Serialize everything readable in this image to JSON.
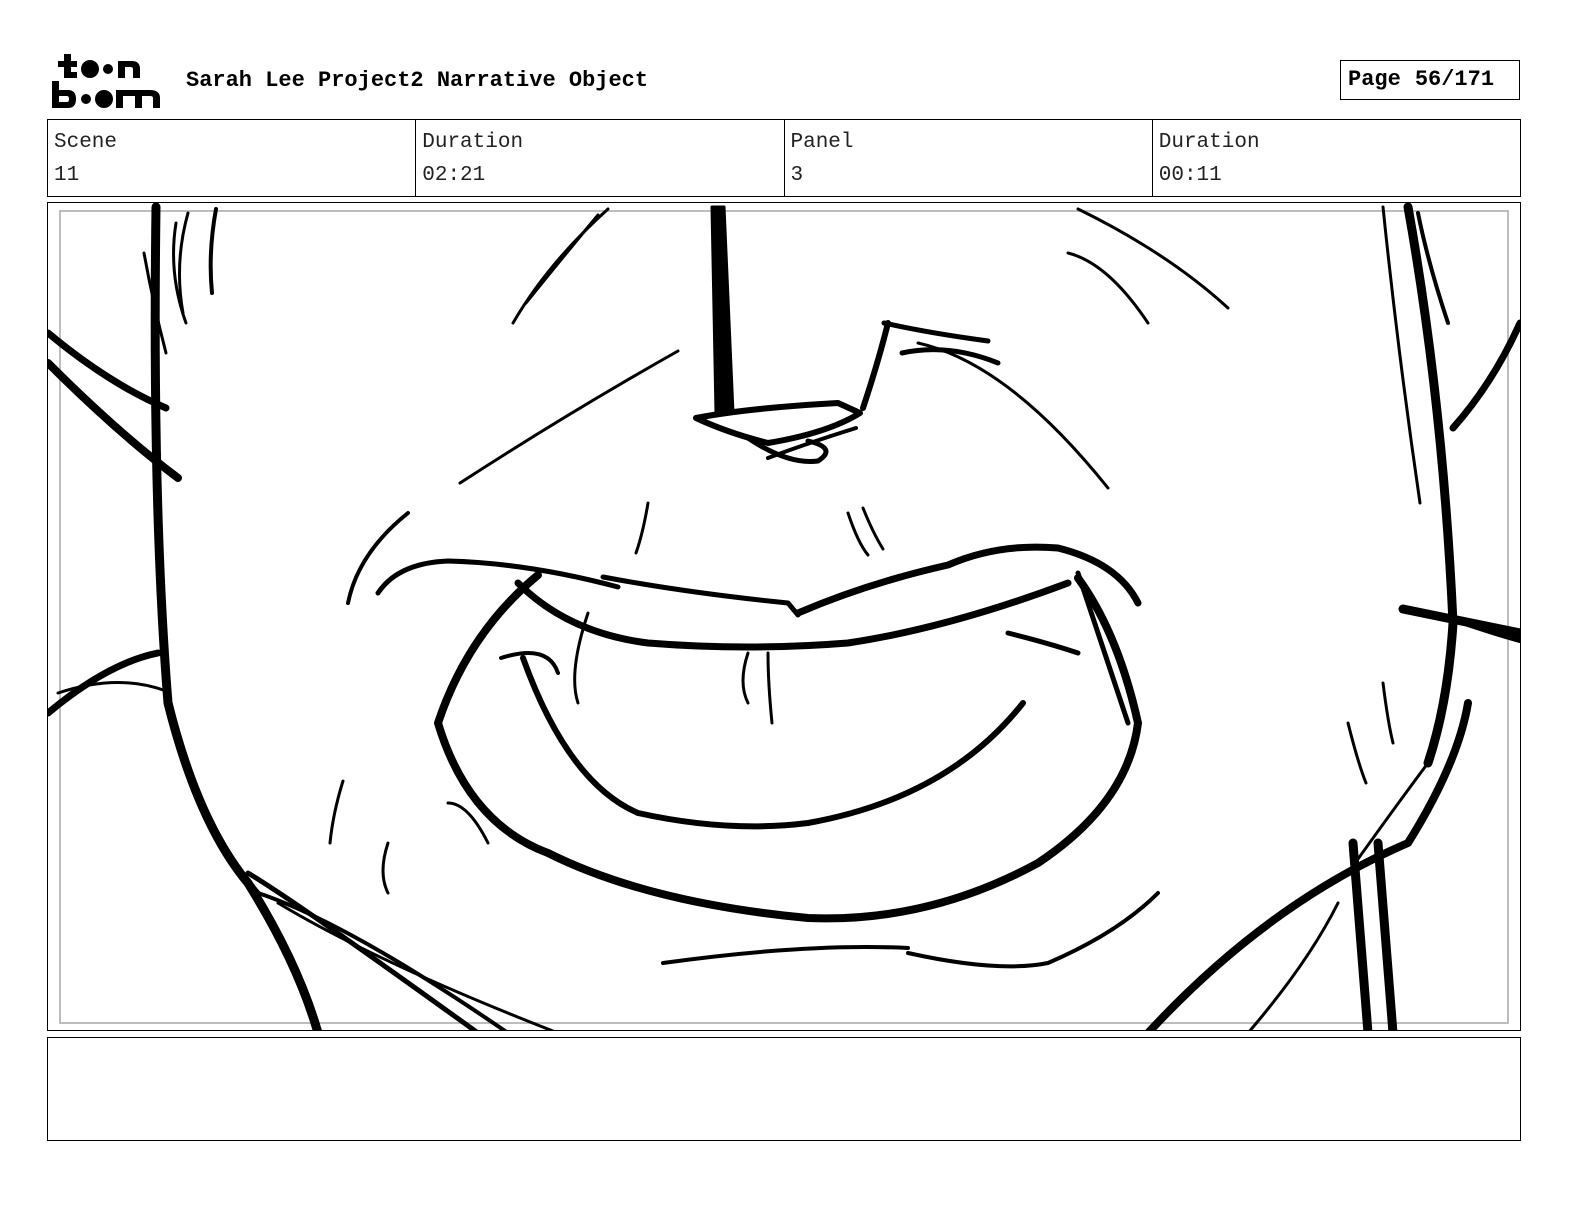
{
  "header": {
    "logo_text_top": "toon",
    "logo_text_bottom": "boom",
    "project_title": "Sarah Lee Project2 Narrative Object",
    "page_label": "Page",
    "page_number": "56/171"
  },
  "info": {
    "scene_label": "Scene",
    "scene_value": "11",
    "scene_duration_label": "Duration",
    "scene_duration_value": "02:21",
    "panel_label": "Panel",
    "panel_value": "3",
    "panel_duration_label": "Duration",
    "panel_duration_value": "00:11"
  },
  "notes": {
    "text": ""
  }
}
